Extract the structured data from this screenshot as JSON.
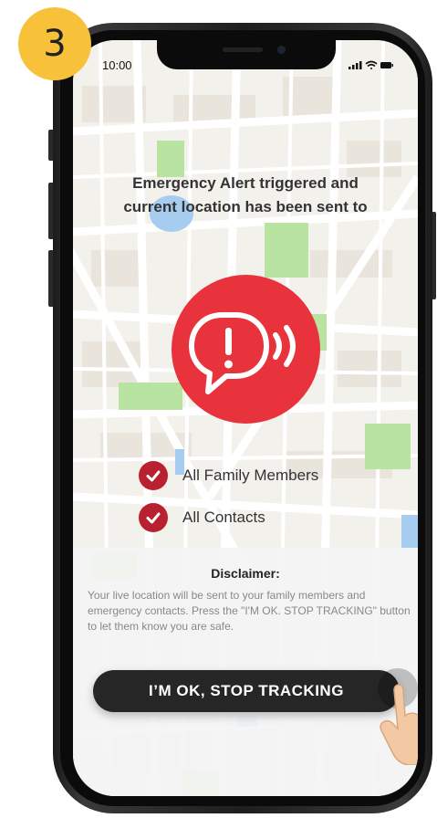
{
  "step_badge": "3",
  "status_bar": {
    "time": "10:00"
  },
  "alert": {
    "heading_line1": "Emergency Alert triggered and",
    "heading_line2": "current location has been sent to",
    "recipients": [
      {
        "label": "All Family Members"
      },
      {
        "label": "All Contacts"
      }
    ]
  },
  "disclaimer": {
    "title": "Disclaimer:",
    "text": "Your live location will be sent to your family members and emergency contacts. Press the \"I'M OK. STOP TRACKING\" button to let them know you are safe."
  },
  "stop_button": {
    "label": "I’M OK, STOP TRACKING"
  },
  "colors": {
    "badge": "#f7c23a",
    "alert_red": "#e8323c",
    "check_red": "#b82230",
    "button_dark": "#262626",
    "map_park": "#b8e3a0",
    "map_water": "#a6cdf0"
  },
  "icons": {
    "alert": "speech-bubble-exclamation-icon",
    "check": "check-circle-icon",
    "hand": "tapping-hand-icon"
  }
}
